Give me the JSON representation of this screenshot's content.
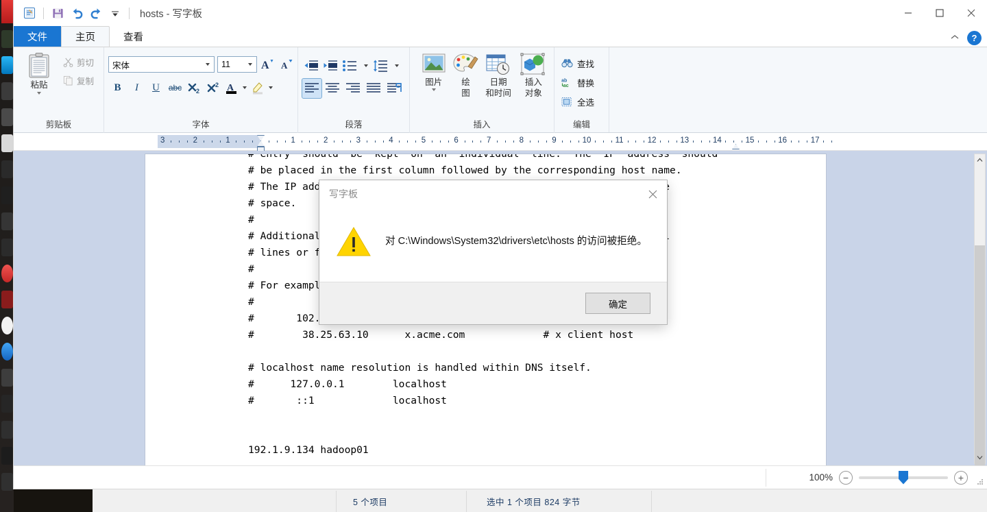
{
  "window": {
    "title": "hosts - 写字板",
    "quick_access": [
      {
        "name": "app-icon",
        "glyph": "A"
      },
      {
        "name": "save-icon",
        "glyph": "save"
      },
      {
        "name": "undo-icon",
        "glyph": "undo"
      },
      {
        "name": "redo-icon",
        "glyph": "redo"
      },
      {
        "name": "customize-qat-icon",
        "glyph": "▾"
      }
    ],
    "controls": {
      "minimize": "—",
      "maximize": "□",
      "close": "✕"
    }
  },
  "tabs": [
    {
      "label": "文件",
      "name": "tab-file"
    },
    {
      "label": "主页",
      "name": "tab-home"
    },
    {
      "label": "查看",
      "name": "tab-view"
    }
  ],
  "tab_right": {
    "collapse": "⌃",
    "help": "?"
  },
  "ribbon": {
    "clipboard": {
      "label": "剪贴板",
      "paste": "粘贴",
      "cut": "剪切",
      "copy": "复制"
    },
    "font": {
      "label": "字体",
      "font_family": "宋体",
      "font_size": "11",
      "grow": "A",
      "shrink": "A",
      "bold": "B",
      "italic": "I",
      "underline": "U",
      "strikethrough": "abc",
      "subscript": "X₂",
      "superscript": "X²",
      "text_color": "A",
      "highlight": "✎"
    },
    "paragraph": {
      "label": "段落",
      "decrease_indent": "",
      "increase_indent": "",
      "bullets": "",
      "line_spacing": "",
      "align_left": "",
      "align_center": "",
      "align_right": "",
      "justify": "",
      "paragraph_mark": ""
    },
    "insert": {
      "label": "插入",
      "items": [
        {
          "name": "insert-picture-button",
          "line1": "图片",
          "line2": "",
          "caret": true
        },
        {
          "name": "insert-paint-drawing-button",
          "line1": "绘",
          "line2": "图",
          "caret": false
        },
        {
          "name": "insert-datetime-button",
          "line1": "日期",
          "line2": "和时间",
          "caret": false
        },
        {
          "name": "insert-object-button",
          "line1": "插入",
          "line2": "对象",
          "caret": false
        }
      ]
    },
    "editing": {
      "label": "编辑",
      "find": "查找",
      "replace": "替换",
      "select_all": "全选"
    }
  },
  "ruler": {
    "left_numbers": [
      "3",
      "2",
      "1"
    ],
    "right_numbers": [
      "1",
      "2",
      "3",
      "4",
      "5",
      "6",
      "7",
      "8",
      "9",
      "10",
      "11",
      "12",
      "13",
      "14",
      "15",
      "16",
      "17"
    ]
  },
  "document": {
    "lines": [
      "# entry  should  be  kept  on  an  individual  line.  The  IP  address  should",
      "# be placed in the first column followed by the corresponding host name.",
      "# The IP address and the host name should be separated by at least one",
      "# space.",
      "#",
      "# Additionally, comments (such as these) may be inserted on individual",
      "# lines or following the machine name denoted by a '#' symbol.",
      "#",
      "# For example:",
      "#",
      "#       102.54.94.97      rhino.acme.com         # source server",
      "#        38.25.63.10      x.acme.com             # x client host",
      "",
      "# localhost name resolution is handled within DNS itself.",
      "#      127.0.0.1        localhost",
      "#       ::1             localhost",
      "",
      "",
      "192.1.9.134 hadoop01"
    ]
  },
  "statusbar": {
    "zoom_label": "100%",
    "zoom_out": "−",
    "zoom_in": "+"
  },
  "dialog": {
    "title": "写字板",
    "close": "✕",
    "icon": "warning-icon",
    "message": "对 C:\\Windows\\System32\\drivers\\etc\\hosts 的访问被拒绝。",
    "ok": "确定"
  },
  "background_window": {
    "item_count": "5 个项目",
    "selection": "选中 1 个项目  824 字节"
  },
  "colors": {
    "accent": "#1a76d2",
    "file_tab": "#1a76d2",
    "ribbon_bg": "#f5f8fb",
    "editor_bg": "#c9d4e8",
    "warning_yellow": "#ffd400"
  }
}
